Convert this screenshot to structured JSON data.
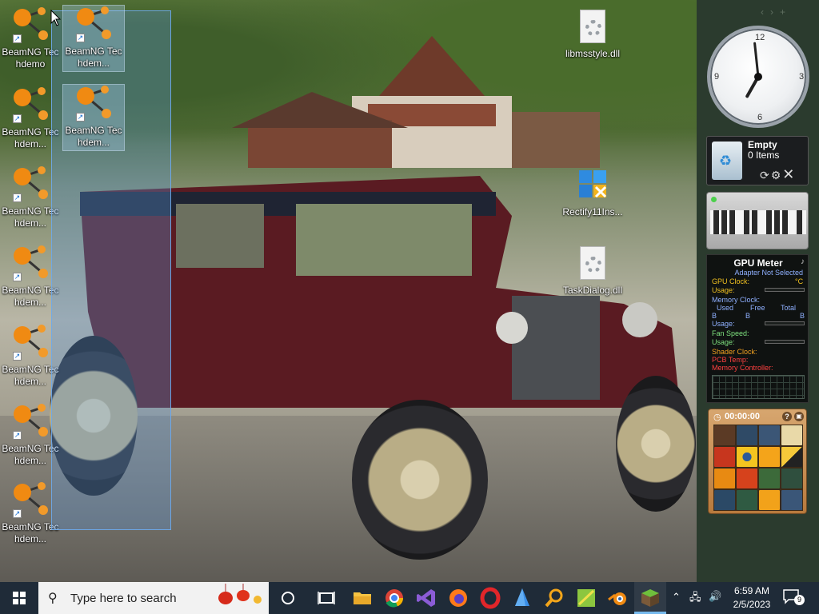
{
  "desktop": {
    "left_column": [
      {
        "label": "BeamNG Techdemo"
      },
      {
        "label": "BeamNG Techdem..."
      },
      {
        "label": "BeamNG Techdem..."
      },
      {
        "label": "BeamNG Techdem..."
      },
      {
        "label": "BeamNG Techdem..."
      },
      {
        "label": "BeamNG Techdem..."
      },
      {
        "label": "BeamNG Techdem..."
      }
    ],
    "selected_column": [
      {
        "label": "BeamNG Techdem..."
      },
      {
        "label": "BeamNG Techdem..."
      }
    ],
    "files": {
      "libmsstyle": "libmsstyle.dll",
      "rectify": "Rectify11Ins...",
      "taskdialog": "TaskDialog.dll"
    }
  },
  "gadgets": {
    "clock": {
      "time": "6:59",
      "numerals": [
        "12",
        "3",
        "6",
        "9"
      ]
    },
    "recycle_bin": {
      "title": "Empty",
      "count": "0 Items"
    },
    "gpu_meter": {
      "title": "GPU Meter",
      "adapter": "Adapter Not Selected",
      "gpu_clock": "GPU Clock:",
      "gpu_clock_unit": "°C",
      "usage_1": "Usage:",
      "memory_clock": "Memory Clock:",
      "used": "Used",
      "free": "Free",
      "total": "Total",
      "b1": "B",
      "b2": "B",
      "b3": "B",
      "usage_2": "Usage:",
      "fan_speed": "Fan Speed:",
      "usage_3": "Usage:",
      "shader_clock": "Shader Clock:",
      "pcb_temp": "PCB Temp:",
      "memory_controller": "Memory Controller:"
    },
    "puzzle": {
      "timer": "00:00:00",
      "help": "?"
    },
    "colors": {
      "gpu_text": "#f0c020",
      "gpu_blue": "#8fb0ff",
      "gpu_red": "#ff4040"
    }
  },
  "taskbar": {
    "search_placeholder": "Type here to search",
    "apps": [
      "cortana-icon",
      "task-view-icon",
      "file-explorer-icon",
      "chrome-icon",
      "visual-studio-icon",
      "firefox-icon",
      "opera-icon",
      "azure-data-icon",
      "search-tool-icon",
      "grapher-icon",
      "blender-icon",
      "minecraft-icon"
    ],
    "time": "6:59 AM",
    "date": "2/5/2023",
    "notification_count": "9"
  }
}
